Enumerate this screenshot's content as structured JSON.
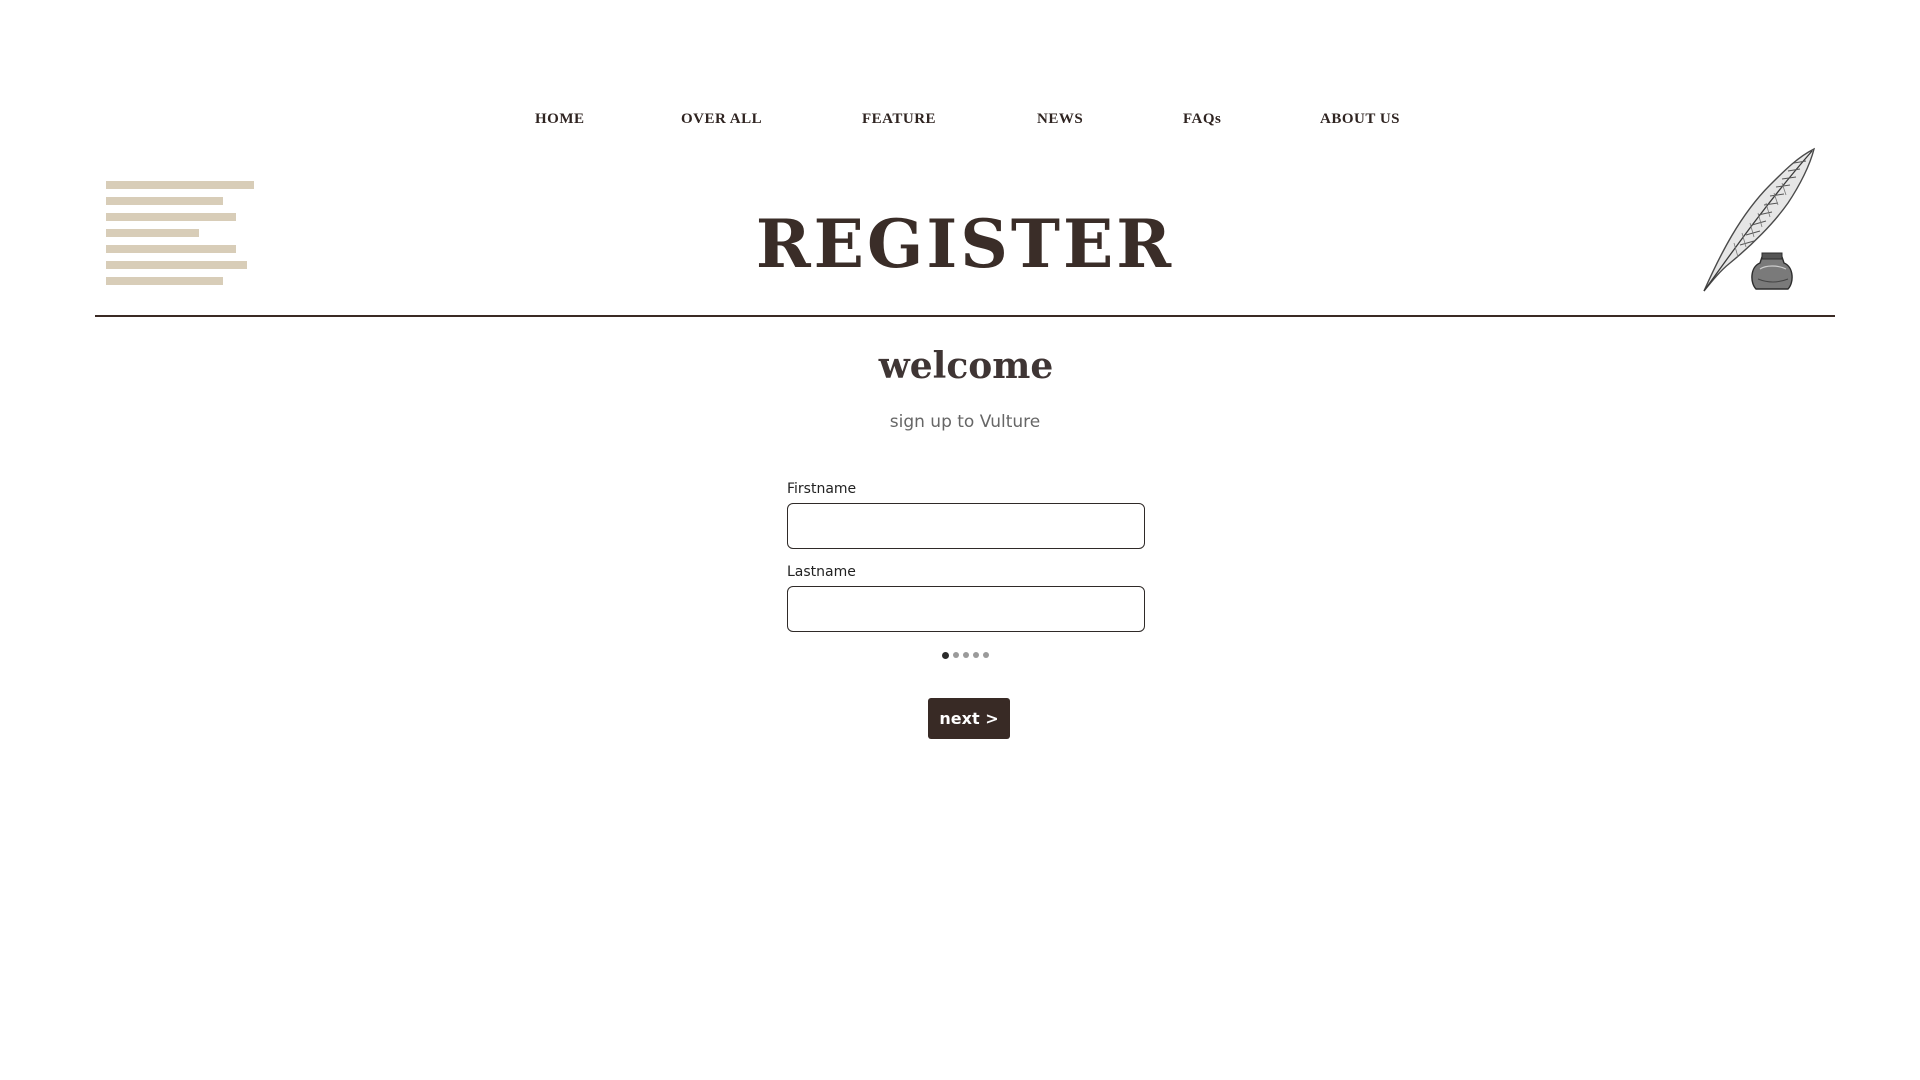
{
  "nav": {
    "items": [
      {
        "label": "HOME"
      },
      {
        "label": "OVER ALL"
      },
      {
        "label": "FEATURE"
      },
      {
        "label": "NEWS"
      },
      {
        "label": "FAQs"
      },
      {
        "label": "ABOUT US"
      }
    ]
  },
  "header": {
    "title": "REGISTER",
    "decoration_icon": "quill-inkwell-icon",
    "lines_icon": "text-lines-icon"
  },
  "main": {
    "welcome": "welcome",
    "subtitle": "sign up to Vulture",
    "fields": [
      {
        "label": "Firstname",
        "value": "",
        "placeholder": ""
      },
      {
        "label": "Lastname",
        "value": "",
        "placeholder": ""
      }
    ],
    "step": {
      "current": 1,
      "total": 5
    },
    "next_label": "next >"
  },
  "colors": {
    "primary": "#382a25",
    "decor_lines": "#d8cdb8",
    "text_dark": "#3a2d28"
  }
}
